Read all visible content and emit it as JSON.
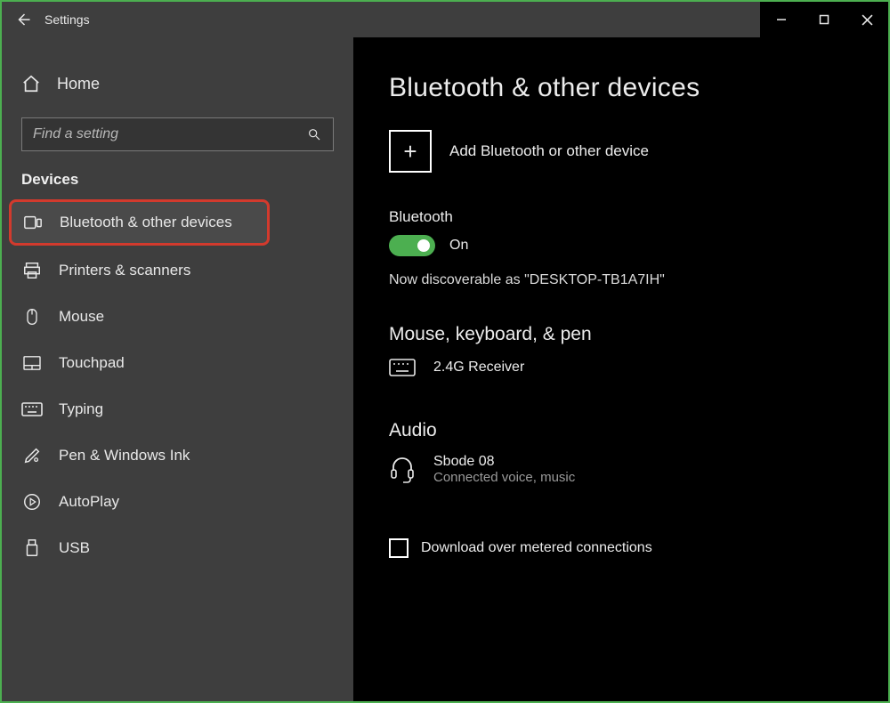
{
  "titlebar": {
    "title": "Settings"
  },
  "sidebar": {
    "home_label": "Home",
    "search_placeholder": "Find a setting",
    "section_label": "Devices",
    "items": [
      {
        "label": "Bluetooth & other devices"
      },
      {
        "label": "Printers & scanners"
      },
      {
        "label": "Mouse"
      },
      {
        "label": "Touchpad"
      },
      {
        "label": "Typing"
      },
      {
        "label": "Pen & Windows Ink"
      },
      {
        "label": "AutoPlay"
      },
      {
        "label": "USB"
      }
    ]
  },
  "main": {
    "heading": "Bluetooth & other devices",
    "add_label": "Add Bluetooth or other device",
    "bluetooth_label": "Bluetooth",
    "toggle_state": "On",
    "discoverable_text": "Now discoverable as \"DESKTOP-TB1A7IH\"",
    "sections": {
      "mkp": {
        "heading": "Mouse, keyboard, & pen",
        "device_name": "2.4G Receiver"
      },
      "audio": {
        "heading": "Audio",
        "device_name": "Sbode 08",
        "device_status": "Connected voice, music"
      }
    },
    "metered_label": "Download over metered connections"
  }
}
